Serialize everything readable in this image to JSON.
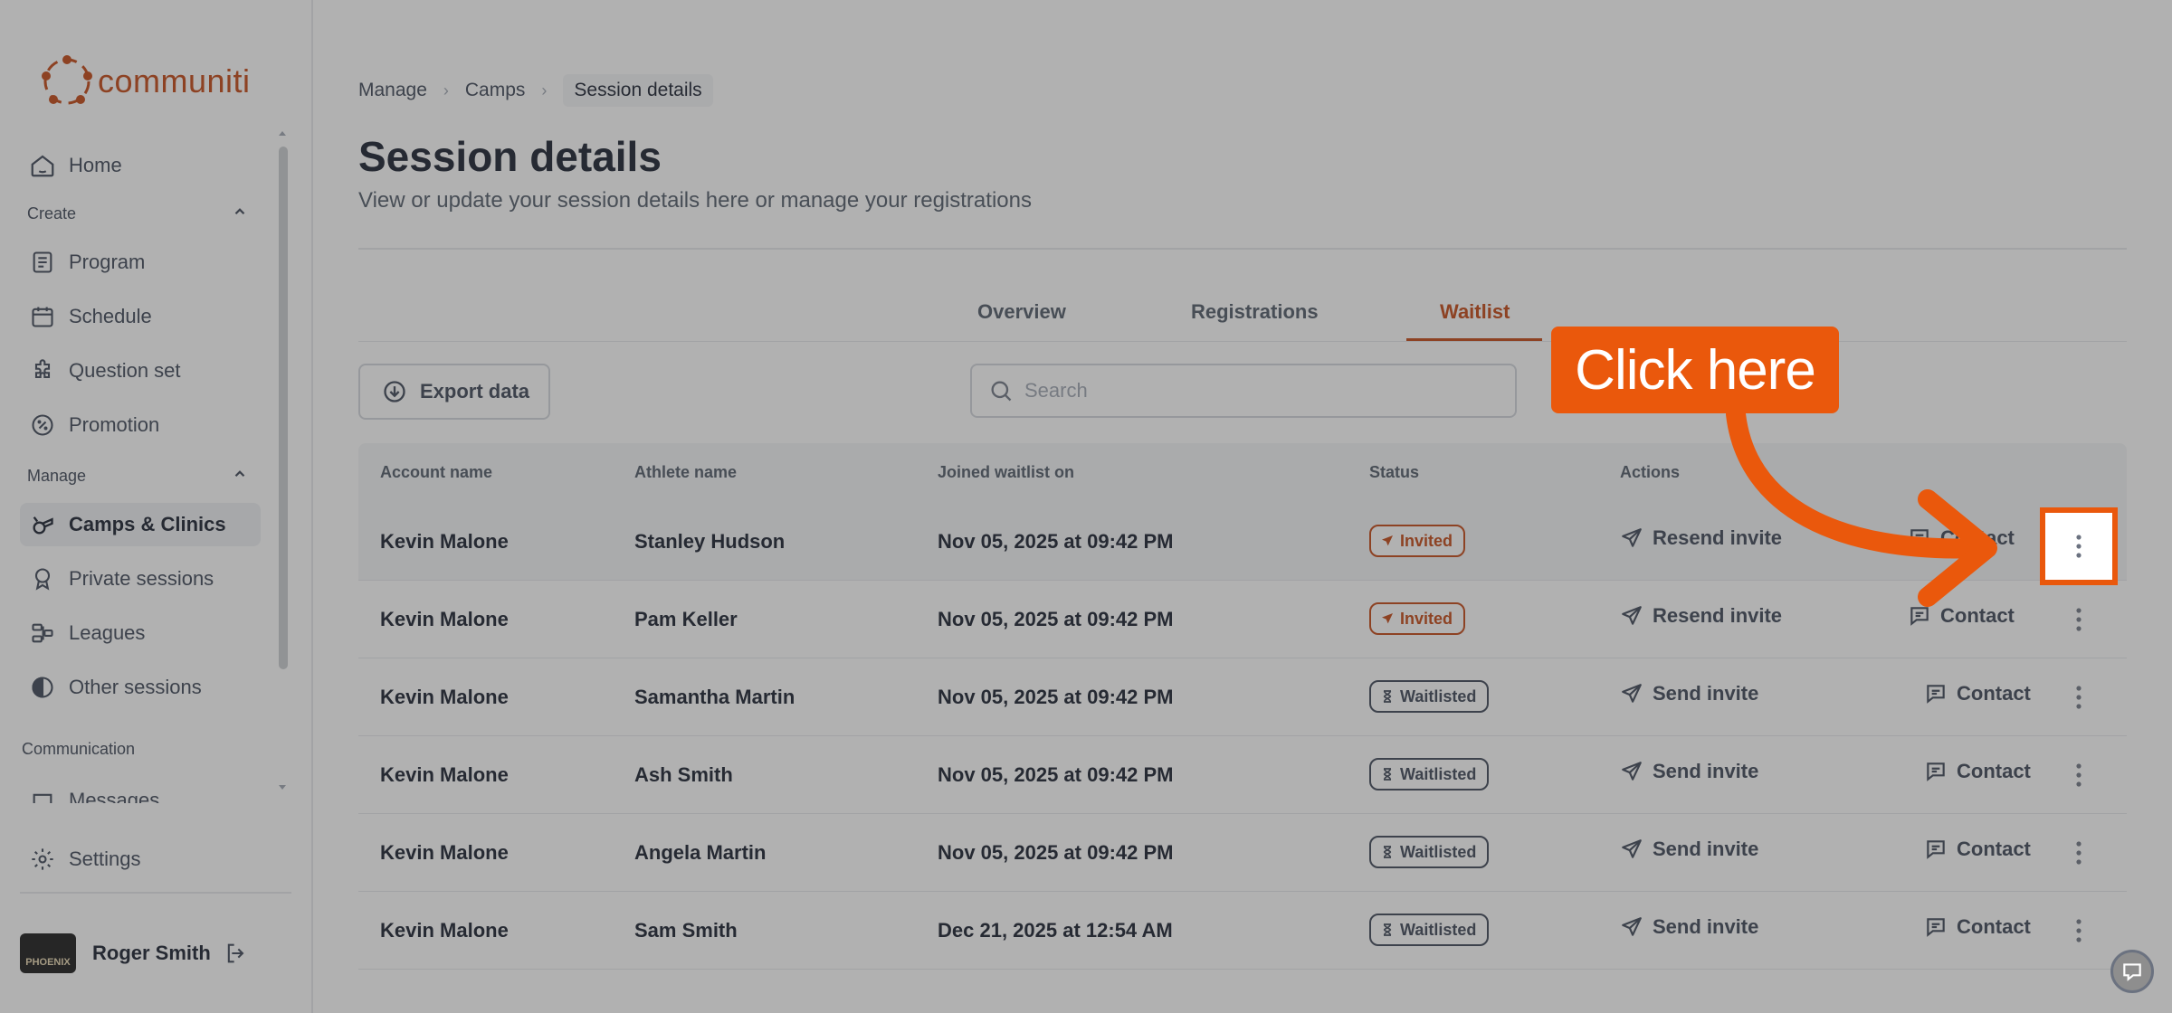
{
  "brand": {
    "name": "communiti",
    "color": "#c2410c"
  },
  "sidebar": {
    "home": "Home",
    "group_create": "Create",
    "create_items": [
      "Program",
      "Schedule",
      "Question set",
      "Promotion"
    ],
    "group_manage": "Manage",
    "manage_items": [
      "Camps & Clinics",
      "Private sessions",
      "Leagues",
      "Other sessions"
    ],
    "group_communication": "Communication",
    "communication_items": [
      "Messages"
    ],
    "settings": "Settings",
    "user": {
      "name": "Roger Smith",
      "avatar_text": "PHOENIX"
    }
  },
  "breadcrumb": [
    "Manage",
    "Camps",
    "Session details"
  ],
  "page": {
    "title": "Session details",
    "subtitle": "View or update your session details here or manage your registrations"
  },
  "tabs": [
    "Overview",
    "Registrations",
    "Waitlist"
  ],
  "active_tab": "Waitlist",
  "toolbar": {
    "export_label": "Export data",
    "search_placeholder": "Search"
  },
  "table": {
    "columns": [
      "Account name",
      "Athlete name",
      "Joined waitlist on",
      "Status",
      "Actions"
    ],
    "rows": [
      {
        "account": "Kevin Malone",
        "athlete": "Stanley Hudson",
        "joined": "Nov 05, 2025 at 09:42 PM",
        "status": "Invited",
        "action": "Resend invite",
        "contact": "Contact"
      },
      {
        "account": "Kevin Malone",
        "athlete": "Pam Keller",
        "joined": "Nov 05, 2025 at 09:42 PM",
        "status": "Invited",
        "action": "Resend invite",
        "contact": "Contact"
      },
      {
        "account": "Kevin Malone",
        "athlete": "Samantha Martin",
        "joined": "Nov 05, 2025 at 09:42 PM",
        "status": "Waitlisted",
        "action": "Send invite",
        "contact": "Contact"
      },
      {
        "account": "Kevin Malone",
        "athlete": "Ash Smith",
        "joined": "Nov 05, 2025 at 09:42 PM",
        "status": "Waitlisted",
        "action": "Send invite",
        "contact": "Contact"
      },
      {
        "account": "Kevin Malone",
        "athlete": "Angela Martin",
        "joined": "Nov 05, 2025 at 09:42 PM",
        "status": "Waitlisted",
        "action": "Send invite",
        "contact": "Contact"
      },
      {
        "account": "Kevin Malone",
        "athlete": "Sam Smith",
        "joined": "Dec 21, 2025 at 12:54 AM",
        "status": "Waitlisted",
        "action": "Send invite",
        "contact": "Contact"
      }
    ]
  },
  "callout": {
    "text": "Click here",
    "color": "#ea580c"
  }
}
